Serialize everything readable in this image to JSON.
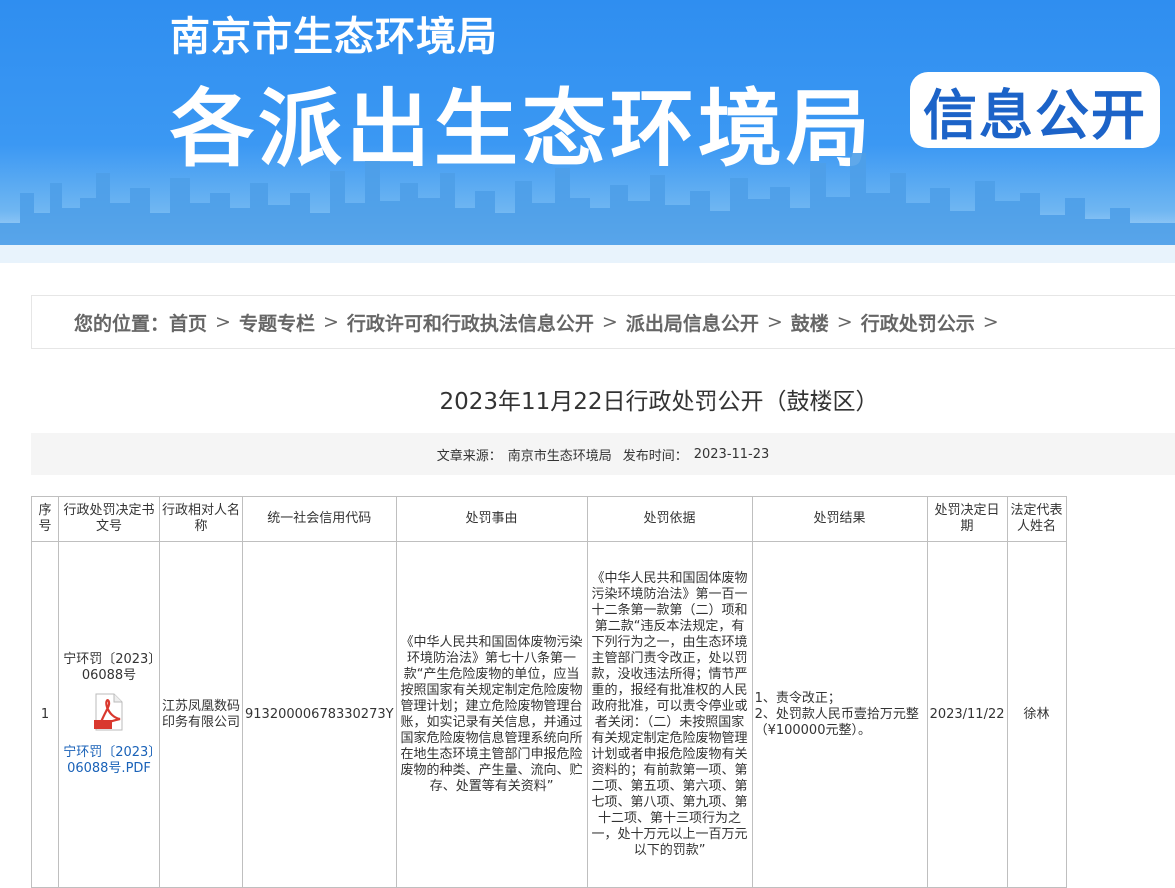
{
  "banner": {
    "org": "南京市生态环境局",
    "main": "各派出生态环境局",
    "badge": "信息公开"
  },
  "breadcrumb": {
    "prefix": "您的位置：",
    "items": [
      "首页",
      "专题专栏",
      "行政许可和行政执法信息公开",
      "派出局信息公开",
      "鼓楼",
      "行政处罚公示"
    ],
    "separator": ">"
  },
  "article": {
    "title": "2023年11月22日行政处罚公开（鼓楼区）",
    "source_label": "文章来源：",
    "source": "南京市生态环境局",
    "date_label": "发布时间：",
    "date": "2023-11-23"
  },
  "table": {
    "headers": [
      "序号",
      "行政处罚决定书文号",
      "行政相对人名称",
      "统一社会信用代码",
      "处罚事由",
      "处罚依据",
      "处罚结果",
      "处罚决定日期",
      "法定代表人姓名"
    ],
    "rows": [
      {
        "no": "1",
        "doc_no": "宁环罚〔2023〕06088号",
        "file_link": "宁环罚〔2023〕06088号.PDF",
        "party": "江苏凤凰数码印务有限公司",
        "credit_code": "91320000678330273Y",
        "reason": "《中华人民共和国固体废物污染环境防治法》第七十八条第一款“产生危险废物的单位，应当按照国家有关规定制定危险废物管理计划；建立危险废物管理台账，如实记录有关信息，并通过国家危险废物信息管理系统向所在地生态环境主管部门申报危险废物的种类、产生量、流向、贮存、处置等有关资料”",
        "basis": "《中华人民共和国固体废物污染环境防治法》第一百一十二条第一款第（二）项和第二款“违反本法规定，有下列行为之一，由生态环境主管部门责令改正，处以罚款，没收违法所得；情节严重的，报经有批准权的人民政府批准，可以责令停业或者关闭：（二）未按照国家有关规定制定危险废物管理计划或者申报危险废物有关资料的；有前款第一项、第二项、第五项、第六项、第七项、第八项、第九项、第十二项、第十三项行为之一，处十万元以上一百万元以下的罚款”",
        "result": "1、责令改正；\n2、处罚款人民币壹拾万元整（¥100000元整）。",
        "date": "2023/11/22",
        "legal_rep": "徐林"
      }
    ]
  },
  "icons": {
    "pdf": "pdf-file-icon"
  },
  "colors": {
    "banner": "#3b98f3",
    "badge_text": "#1c63c8",
    "link": "#1a62b8"
  }
}
